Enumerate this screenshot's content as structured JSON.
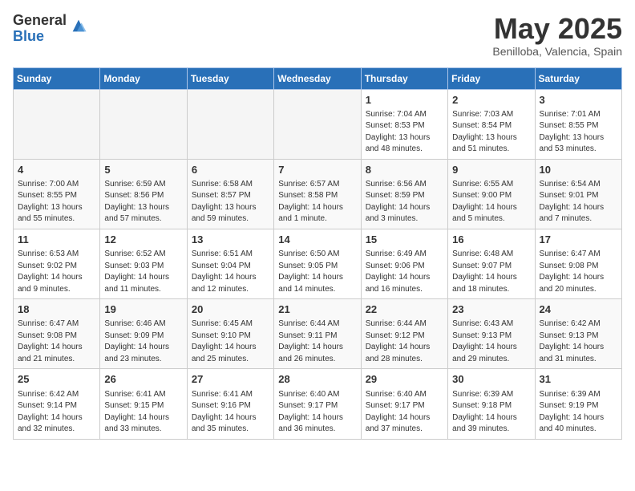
{
  "logo": {
    "general": "General",
    "blue": "Blue"
  },
  "title": "May 2025",
  "subtitle": "Benilloba, Valencia, Spain",
  "days_header": [
    "Sunday",
    "Monday",
    "Tuesday",
    "Wednesday",
    "Thursday",
    "Friday",
    "Saturday"
  ],
  "weeks": [
    [
      {
        "num": "",
        "empty": true
      },
      {
        "num": "",
        "empty": true
      },
      {
        "num": "",
        "empty": true
      },
      {
        "num": "",
        "empty": true
      },
      {
        "num": "1",
        "sunrise": "7:04 AM",
        "sunset": "8:53 PM",
        "daylight": "13 hours and 48 minutes."
      },
      {
        "num": "2",
        "sunrise": "7:03 AM",
        "sunset": "8:54 PM",
        "daylight": "13 hours and 51 minutes."
      },
      {
        "num": "3",
        "sunrise": "7:01 AM",
        "sunset": "8:55 PM",
        "daylight": "13 hours and 53 minutes."
      }
    ],
    [
      {
        "num": "4",
        "sunrise": "7:00 AM",
        "sunset": "8:55 PM",
        "daylight": "13 hours and 55 minutes."
      },
      {
        "num": "5",
        "sunrise": "6:59 AM",
        "sunset": "8:56 PM",
        "daylight": "13 hours and 57 minutes."
      },
      {
        "num": "6",
        "sunrise": "6:58 AM",
        "sunset": "8:57 PM",
        "daylight": "13 hours and 59 minutes."
      },
      {
        "num": "7",
        "sunrise": "6:57 AM",
        "sunset": "8:58 PM",
        "daylight": "14 hours and 1 minute."
      },
      {
        "num": "8",
        "sunrise": "6:56 AM",
        "sunset": "8:59 PM",
        "daylight": "14 hours and 3 minutes."
      },
      {
        "num": "9",
        "sunrise": "6:55 AM",
        "sunset": "9:00 PM",
        "daylight": "14 hours and 5 minutes."
      },
      {
        "num": "10",
        "sunrise": "6:54 AM",
        "sunset": "9:01 PM",
        "daylight": "14 hours and 7 minutes."
      }
    ],
    [
      {
        "num": "11",
        "sunrise": "6:53 AM",
        "sunset": "9:02 PM",
        "daylight": "14 hours and 9 minutes."
      },
      {
        "num": "12",
        "sunrise": "6:52 AM",
        "sunset": "9:03 PM",
        "daylight": "14 hours and 11 minutes."
      },
      {
        "num": "13",
        "sunrise": "6:51 AM",
        "sunset": "9:04 PM",
        "daylight": "14 hours and 12 minutes."
      },
      {
        "num": "14",
        "sunrise": "6:50 AM",
        "sunset": "9:05 PM",
        "daylight": "14 hours and 14 minutes."
      },
      {
        "num": "15",
        "sunrise": "6:49 AM",
        "sunset": "9:06 PM",
        "daylight": "14 hours and 16 minutes."
      },
      {
        "num": "16",
        "sunrise": "6:48 AM",
        "sunset": "9:07 PM",
        "daylight": "14 hours and 18 minutes."
      },
      {
        "num": "17",
        "sunrise": "6:47 AM",
        "sunset": "9:08 PM",
        "daylight": "14 hours and 20 minutes."
      }
    ],
    [
      {
        "num": "18",
        "sunrise": "6:47 AM",
        "sunset": "9:08 PM",
        "daylight": "14 hours and 21 minutes."
      },
      {
        "num": "19",
        "sunrise": "6:46 AM",
        "sunset": "9:09 PM",
        "daylight": "14 hours and 23 minutes."
      },
      {
        "num": "20",
        "sunrise": "6:45 AM",
        "sunset": "9:10 PM",
        "daylight": "14 hours and 25 minutes."
      },
      {
        "num": "21",
        "sunrise": "6:44 AM",
        "sunset": "9:11 PM",
        "daylight": "14 hours and 26 minutes."
      },
      {
        "num": "22",
        "sunrise": "6:44 AM",
        "sunset": "9:12 PM",
        "daylight": "14 hours and 28 minutes."
      },
      {
        "num": "23",
        "sunrise": "6:43 AM",
        "sunset": "9:13 PM",
        "daylight": "14 hours and 29 minutes."
      },
      {
        "num": "24",
        "sunrise": "6:42 AM",
        "sunset": "9:13 PM",
        "daylight": "14 hours and 31 minutes."
      }
    ],
    [
      {
        "num": "25",
        "sunrise": "6:42 AM",
        "sunset": "9:14 PM",
        "daylight": "14 hours and 32 minutes."
      },
      {
        "num": "26",
        "sunrise": "6:41 AM",
        "sunset": "9:15 PM",
        "daylight": "14 hours and 33 minutes."
      },
      {
        "num": "27",
        "sunrise": "6:41 AM",
        "sunset": "9:16 PM",
        "daylight": "14 hours and 35 minutes."
      },
      {
        "num": "28",
        "sunrise": "6:40 AM",
        "sunset": "9:17 PM",
        "daylight": "14 hours and 36 minutes."
      },
      {
        "num": "29",
        "sunrise": "6:40 AM",
        "sunset": "9:17 PM",
        "daylight": "14 hours and 37 minutes."
      },
      {
        "num": "30",
        "sunrise": "6:39 AM",
        "sunset": "9:18 PM",
        "daylight": "14 hours and 39 minutes."
      },
      {
        "num": "31",
        "sunrise": "6:39 AM",
        "sunset": "9:19 PM",
        "daylight": "14 hours and 40 minutes."
      }
    ]
  ]
}
